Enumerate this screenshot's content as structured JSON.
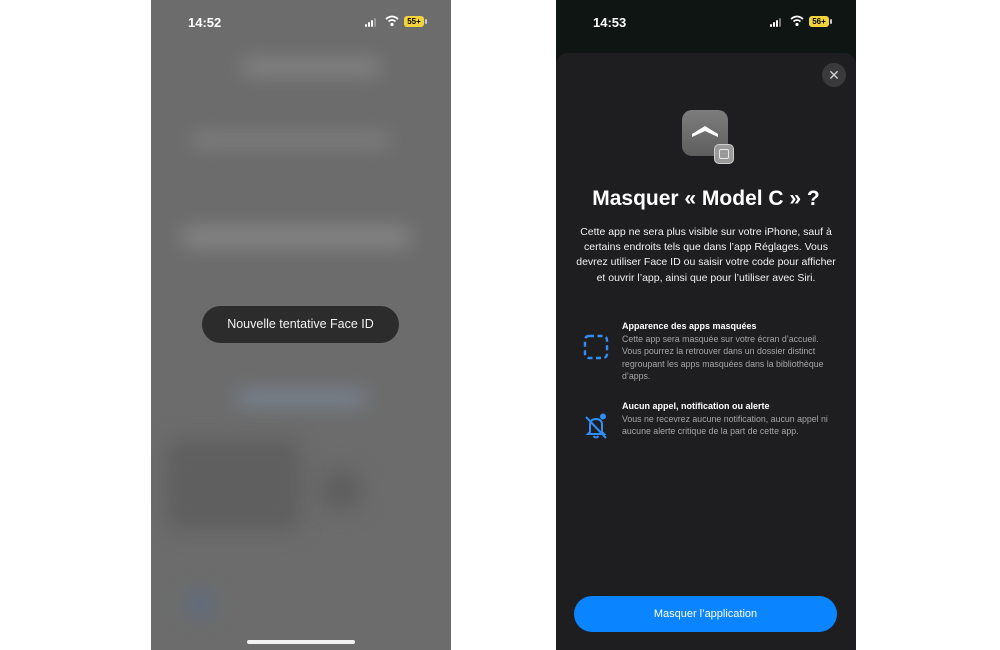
{
  "left_screen": {
    "status_bar": {
      "time": "14:52",
      "battery": "55+"
    },
    "toast": {
      "text": "Nouvelle tentative Face ID"
    }
  },
  "right_screen": {
    "status_bar": {
      "time": "14:53",
      "battery": "56+"
    },
    "sheet": {
      "close_icon": "close-icon",
      "title": "Masquer « Model C » ?",
      "description": "Cette app ne sera plus visible sur votre iPhone, sauf à certains endroits tels que dans l’app Réglages. Vous devrez utiliser Face ID ou saisir votre code pour afficher et ouvrir l’app, ainsi que pour l’utiliser avec Siri.",
      "features": [
        {
          "icon": "dashed-square-icon",
          "title": "Apparence des apps masquées",
          "text": "Cette app sera masquée sur votre écran d’accueil. Vous pourrez la retrouver dans un dossier distinct regroupant les apps masquées dans la bibliothèque d’apps."
        },
        {
          "icon": "bell-slash-icon",
          "title": "Aucun appel, notification ou alerte",
          "text": "Vous ne recevrez aucune notification, aucun appel ni aucune alerte critique de la part de cette app."
        }
      ],
      "primary_button": "Masquer l’application"
    }
  },
  "colors": {
    "accent": "#0a84ff",
    "battery": "#f2d33b",
    "sheet_bg": "#1e1e20"
  }
}
